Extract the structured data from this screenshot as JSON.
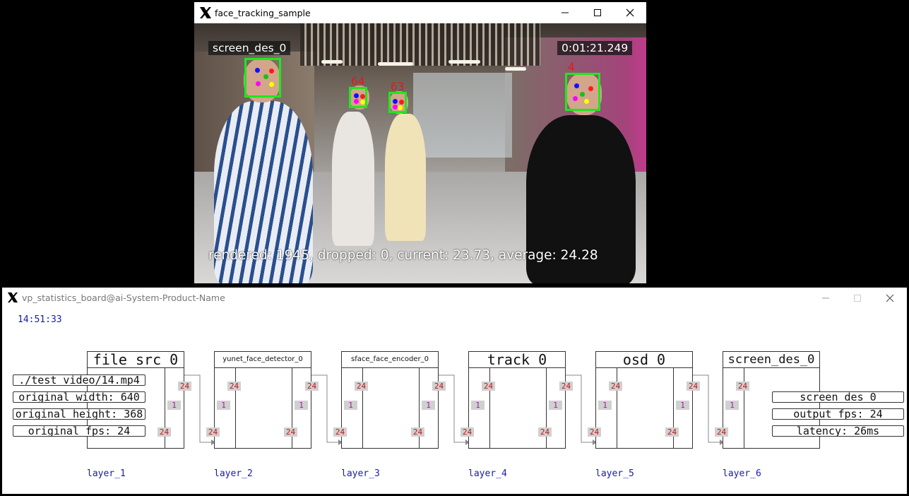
{
  "video_window": {
    "title": "face_tracking_sample",
    "overlay_label": "screen_des_0",
    "timestamp": "0:01:21.249",
    "stats": "rendered: 1945, dropped: 0, current: 23.73, average: 24.28",
    "track_ids": [
      "64",
      "63",
      "4"
    ],
    "icons": [
      "x-logo-icon",
      "minimize-icon",
      "maximize-icon",
      "close-icon"
    ]
  },
  "board_window": {
    "title": "vp_statistics_board@ai-System-Product-Name",
    "clock": "14:51:33",
    "nodes": [
      {
        "name": "file_src_0",
        "in_badge": "24",
        "out_badge": "24",
        "mid_badge": "1",
        "layer": "layer_1"
      },
      {
        "name": "yunet_face_detector_0",
        "in_badge": "24",
        "out_badge": "24",
        "mid_badge": "1",
        "layer": "layer_2",
        "top_left": "24",
        "top_right": "24",
        "bottom_left": "24",
        "bottom_right": "24"
      },
      {
        "name": "sface_face_encoder_0",
        "in_badge": "24",
        "out_badge": "24",
        "mid_badge": "1",
        "layer": "layer_3"
      },
      {
        "name": "track_0",
        "in_badge": "24",
        "out_badge": "24",
        "mid_badge": "1",
        "layer": "layer_4"
      },
      {
        "name": "osd_0",
        "in_badge": "24",
        "out_badge": "24",
        "mid_badge": "1",
        "layer": "layer_5"
      },
      {
        "name": "screen_des_0",
        "in_badge": "24",
        "out_badge": "24",
        "mid_badge": "1",
        "layer": "layer_6"
      }
    ],
    "src_info": [
      "./test_video/14.mp4",
      "original_width: 640",
      "original_height: 368",
      "original_fps: 24"
    ],
    "des_info": [
      "screen_des_0",
      "output_fps: 24",
      "latency: 26ms"
    ],
    "badge_value": "24",
    "badge_one": "1"
  },
  "colors": {
    "face_box": "#1ee81e",
    "track_id": "#e01a1a",
    "clock_text": "#1a1ab0",
    "badge_bg": "#d0d0d0"
  }
}
